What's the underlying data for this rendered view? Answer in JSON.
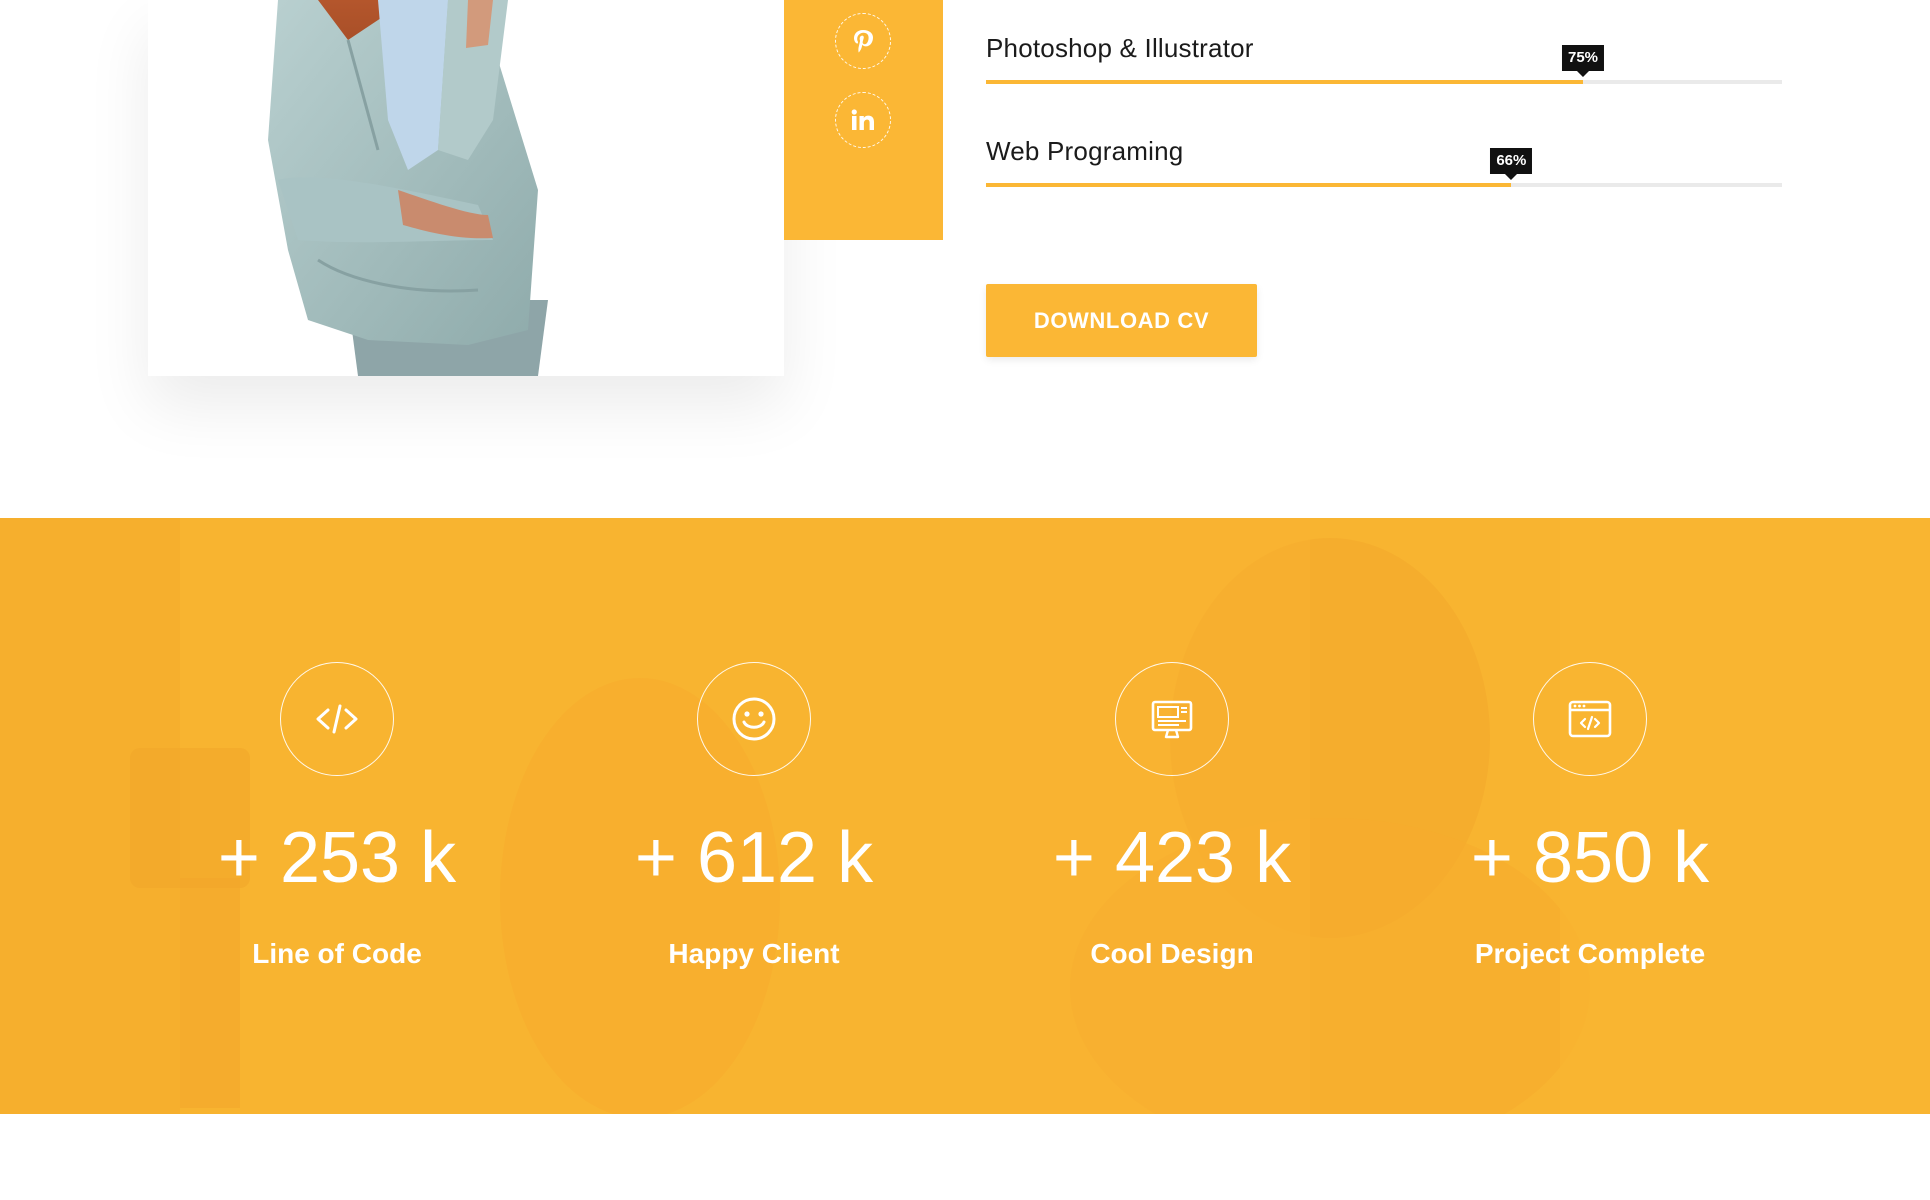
{
  "colors": {
    "accent": "#fbb735",
    "band": "#f8b430",
    "text_dark": "#1b1b1b",
    "tooltip_bg": "#111111",
    "track": "#eaeaea"
  },
  "profile": {
    "photo_alt": "Woman in a light blue blazer with arms crossed"
  },
  "social": [
    {
      "icon": "pinterest-icon"
    },
    {
      "icon": "linkedin-icon"
    }
  ],
  "skills": [
    {
      "label": "Photoshop & Illustrator",
      "percent_text": "75%",
      "value": 0.75
    },
    {
      "label": "Web Programing",
      "percent_text": "66%",
      "value": 0.66
    }
  ],
  "download_button": {
    "label": "DOWNLOAD CV"
  },
  "stats": [
    {
      "icon": "code-icon",
      "number": "+ 253 k",
      "label": "Line of Code"
    },
    {
      "icon": "smiley-icon",
      "number": "+ 612 k",
      "label": "Happy Client"
    },
    {
      "icon": "computer-design-icon",
      "number": "+ 423 k",
      "label": "Cool Design"
    },
    {
      "icon": "browser-code-icon",
      "number": "+ 850 k",
      "label": "Project Complete"
    }
  ]
}
